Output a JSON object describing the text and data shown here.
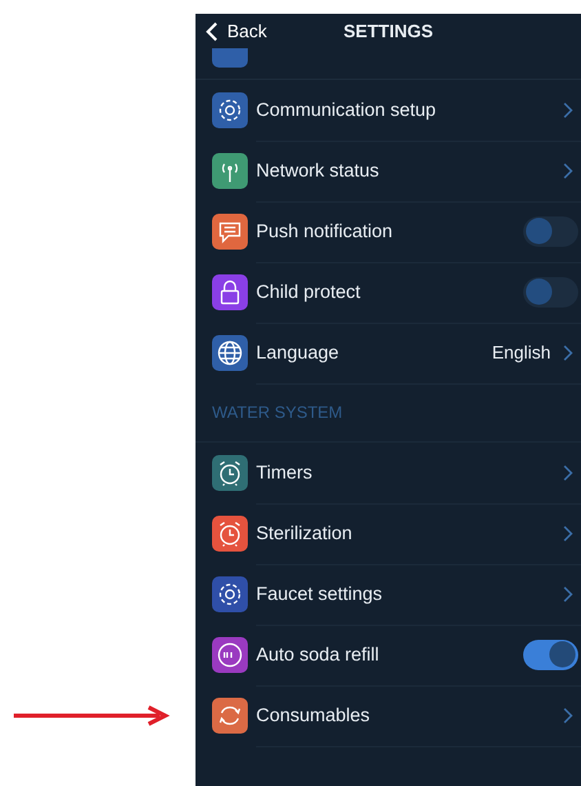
{
  "header": {
    "back": "Back",
    "title": "SETTINGS"
  },
  "sections": [
    {
      "items": [
        {
          "kind": "link",
          "label": "Communication setup",
          "color": "#2f5fa8"
        },
        {
          "kind": "link",
          "label": "Network status",
          "color": "#3f9a73"
        },
        {
          "kind": "toggle",
          "label": "Push notification",
          "color": "#e0673f",
          "on": false
        },
        {
          "kind": "toggle",
          "label": "Child protect",
          "color": "#8a3fe6",
          "on": false
        },
        {
          "kind": "value",
          "label": "Language",
          "color": "#2f5fa8",
          "value": "English"
        }
      ]
    },
    {
      "title": "WATER SYSTEM",
      "items": [
        {
          "kind": "link",
          "label": "Timers",
          "color": "#2f6e74"
        },
        {
          "kind": "link",
          "label": "Sterilization",
          "color": "#e5533e"
        },
        {
          "kind": "link",
          "label": "Faucet settings",
          "color": "#2f4fa8"
        },
        {
          "kind": "toggle",
          "label": "Auto soda refill",
          "color": "#9a3ac0",
          "on": true
        },
        {
          "kind": "link",
          "label": "Consumables",
          "color": "#db6a45"
        }
      ]
    }
  ]
}
